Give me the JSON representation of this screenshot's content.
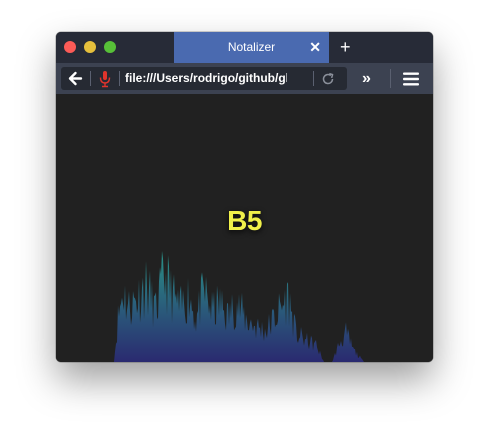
{
  "window": {
    "tab_title": "Notalizer",
    "tab_close": "✕",
    "new_tab": "+"
  },
  "toolbar": {
    "url": "file:///Users/rodrigo/github/gl",
    "overflow_label": "»"
  },
  "page": {
    "note": "B5"
  },
  "colors": {
    "tab_active": "#4a6ab0",
    "note_text": "#f0f04a",
    "spectrum_top": "#2aa58a",
    "spectrum_bottom": "#2a2a70"
  },
  "icons": {
    "back": "arrow-left-icon",
    "mic": "microphone-icon",
    "reload": "reload-icon",
    "menu": "hamburger-menu-icon"
  }
}
